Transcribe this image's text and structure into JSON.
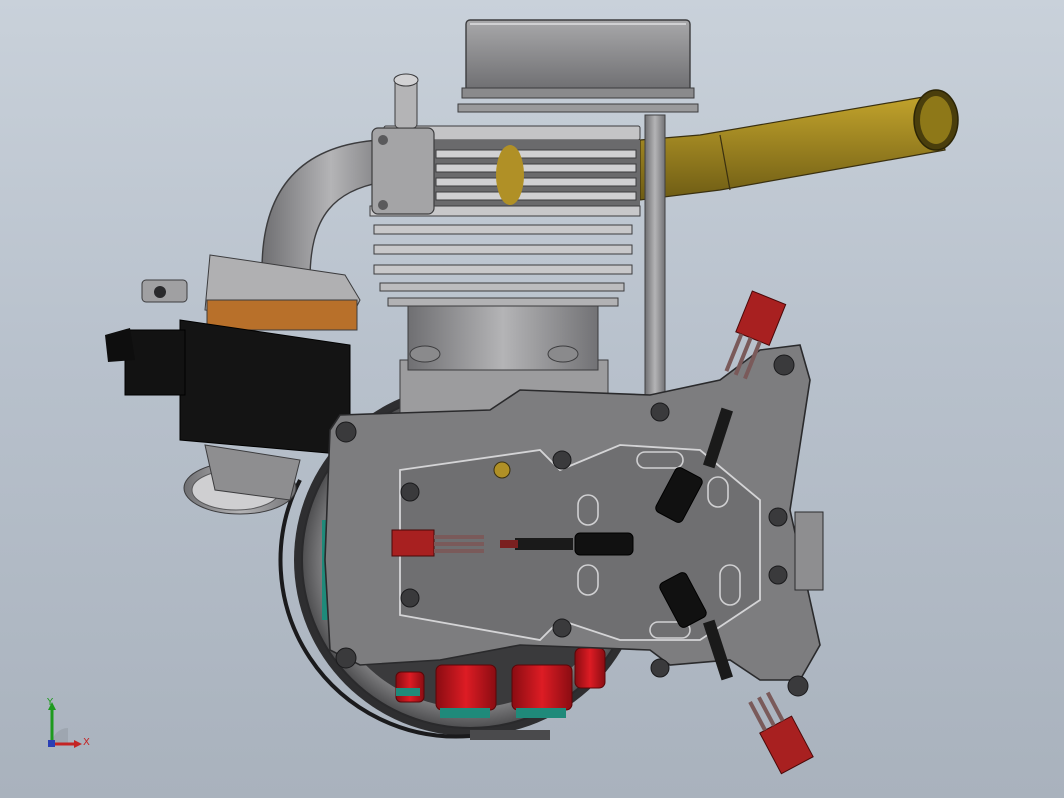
{
  "viewport": {
    "background_top": "#c9d1da",
    "background_bottom": "#a9b2bd"
  },
  "model": {
    "description_shown": false,
    "colors": {
      "metal": "#8e8e90",
      "metal_dark": "#5a5a5c",
      "metal_light": "#b9b9bb",
      "plate": "#7b7b7d",
      "black": "#111111",
      "brass": "#8a7420",
      "brass_light": "#c3a42c",
      "magnet_red": "#c4121a",
      "connector_red": "#a82020",
      "teal": "#1f8a7a",
      "copper": "#b8702a"
    }
  },
  "triad": {
    "y_label": "Y",
    "x_label": "X",
    "y_color": "#1e9a1e",
    "x_color": "#c42424",
    "z_color": "#2a3fb5"
  }
}
